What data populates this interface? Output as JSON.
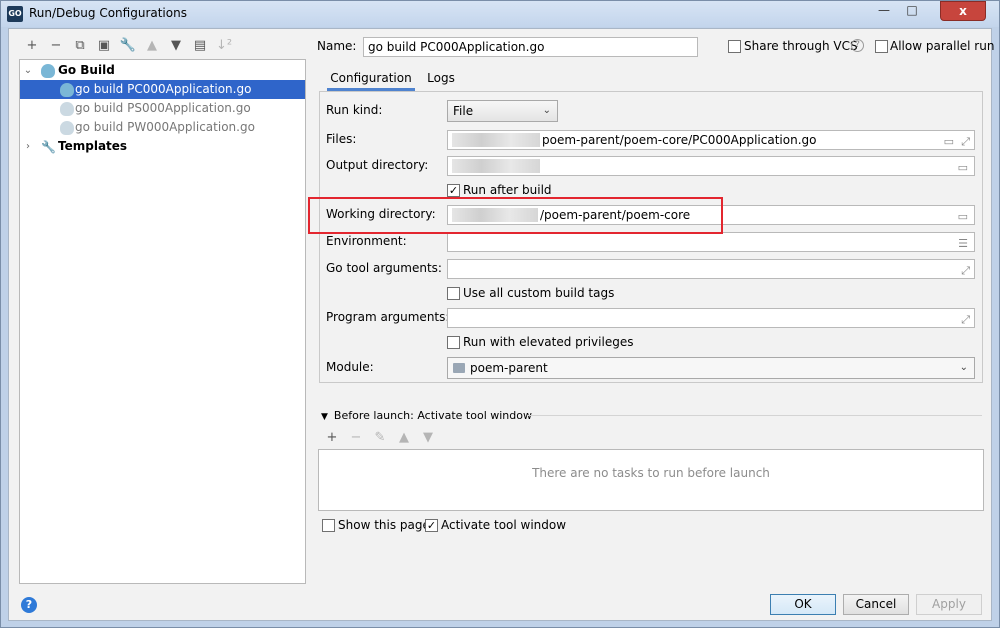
{
  "window": {
    "title": "Run/Debug Configurations",
    "app_icon": "GO",
    "controls": {
      "minimize": "—",
      "maximize": "□",
      "close": "x"
    }
  },
  "toolbar": {
    "icons": [
      "add-icon",
      "remove-icon",
      "copy-icon",
      "save-icon",
      "wrench-icon",
      "move-up-icon",
      "move-down-icon",
      "folder-add-icon",
      "sort-icon"
    ],
    "glyphs": [
      "+",
      "−",
      "⧉",
      "▣",
      "🔧",
      "▲",
      "▼",
      "📁",
      "↓²"
    ]
  },
  "tree": {
    "go_build_label": "Go Build",
    "items": [
      {
        "label": "go build PC000Application.go",
        "selected": true
      },
      {
        "label": "go build PS000Application.go",
        "selected": false
      },
      {
        "label": "go build PW000Application.go",
        "selected": false
      }
    ],
    "templates_label": "Templates"
  },
  "name_row": {
    "label": "Name:",
    "value": "go build PC000Application.go",
    "share_label": "Share through VCS",
    "share_checked": false,
    "help_glyph": "?",
    "parallel_label": "Allow parallel run",
    "parallel_checked": false
  },
  "tabs": [
    "Configuration",
    "Logs"
  ],
  "config": {
    "run_kind_label": "Run kind:",
    "run_kind_value": "File",
    "files_label": "Files:",
    "files_value": "poem-parent/poem-core/PC000Application.go",
    "output_label": "Output directory:",
    "output_value": "",
    "run_after_build_label": "Run after build",
    "run_after_build_checked": true,
    "working_dir_label": "Working directory:",
    "working_dir_value": "/poem-parent/poem-core",
    "environment_label": "Environment:",
    "environment_value": "",
    "go_tool_args_label": "Go tool arguments:",
    "go_tool_args_value": "",
    "custom_tags_label": "Use all custom build tags",
    "custom_tags_checked": false,
    "program_args_label": "Program arguments:",
    "program_args_value": "",
    "elevated_label": "Run with elevated privileges",
    "elevated_checked": false,
    "module_label": "Module:",
    "module_value": "poem-parent"
  },
  "before_launch": {
    "header": "Before launch: Activate tool window",
    "toolbar_glyphs": [
      "+",
      "−",
      "✎",
      "▲",
      "▼"
    ],
    "empty_text": "There are no tasks to run before launch"
  },
  "options": {
    "show_page_label": "Show this page",
    "show_page_checked": false,
    "activate_label": "Activate tool window",
    "activate_checked": true
  },
  "buttons": {
    "ok": "OK",
    "cancel": "Cancel",
    "apply": "Apply"
  },
  "help_button": "?",
  "colors": {
    "selection": "#2f65ca",
    "highlight_border": "#e3262f",
    "close_button": "#c7453d"
  }
}
